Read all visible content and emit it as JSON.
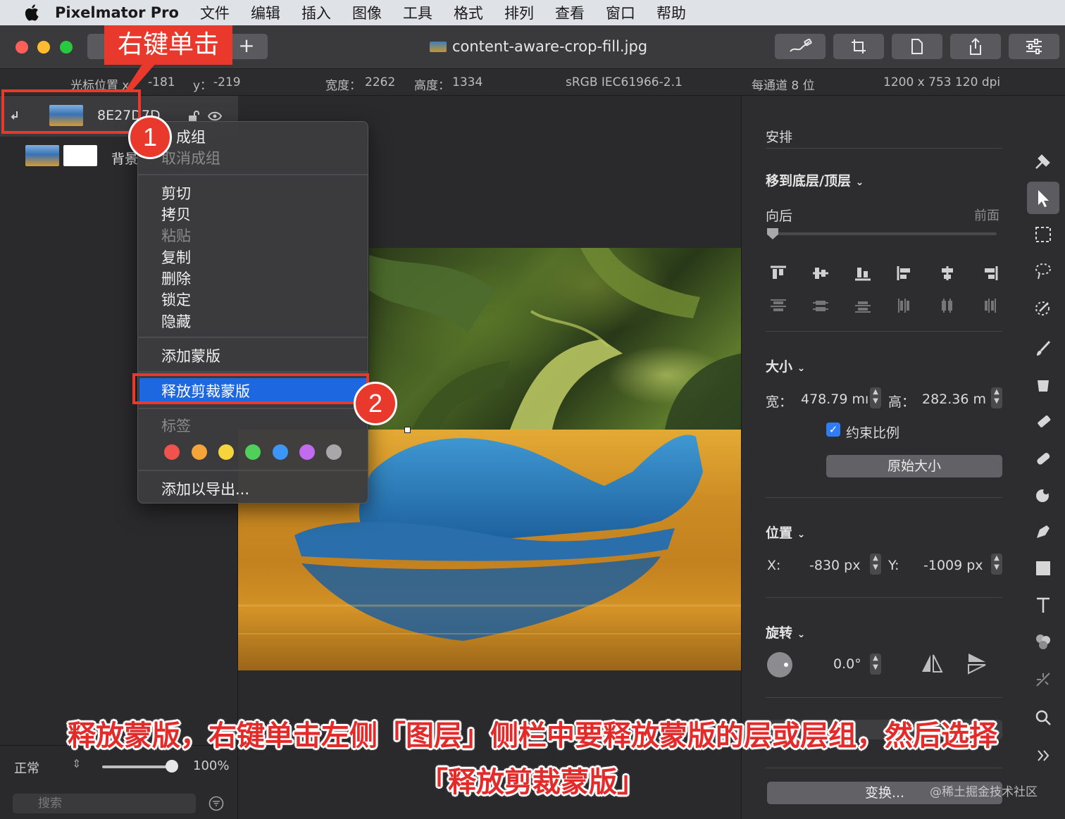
{
  "menubar": {
    "app_name": "Pixelmator Pro",
    "items": [
      "文件",
      "编辑",
      "插入",
      "图像",
      "工具",
      "格式",
      "排列",
      "查看",
      "窗口",
      "帮助"
    ]
  },
  "window": {
    "title": "content-aware-crop-fill.jpg",
    "add_label": "+"
  },
  "infobar": {
    "cursor_x_label": "光标位置 x：",
    "cursor_x": "-181",
    "cursor_y_label": "y：",
    "cursor_y": "-219",
    "width_label": "宽度：",
    "width": "2262",
    "height_label": "高度：",
    "height": "1334",
    "color_profile": "sRGB IEC61966-2.1",
    "bit_depth": "每通道 8 位",
    "resolution": "1200 x 753 120 dpi"
  },
  "layers": {
    "selected_name": "8E27D7D",
    "background_name": "背景"
  },
  "sidebar_bottom": {
    "blend_mode": "正常",
    "opacity": "100%",
    "opacity_value": 1.0,
    "search_placeholder": "搜索"
  },
  "context_menu": {
    "group": "成组",
    "ungroup": "取消成组",
    "cut": "剪切",
    "copy": "拷贝",
    "paste": "粘贴",
    "duplicate": "复制",
    "delete": "删除",
    "lock": "锁定",
    "hide": "隐藏",
    "add_mask": "添加蒙版",
    "release_clipping_mask": "释放剪裁蒙版",
    "tags_label": "标签",
    "tag_colors": [
      "#f0524c",
      "#f5a43a",
      "#f5d43c",
      "#4fd05a",
      "#3b96f5",
      "#c36bf0",
      "#a8a8aa"
    ],
    "add_to_export": "添加以导出..."
  },
  "inspector": {
    "arrange_title": "安排",
    "move_to_bottom_top": "移到底层/顶层",
    "backward": "向后",
    "forward": "前面",
    "size_title": "大小",
    "width_label": "宽：",
    "width_value": "478.79 mı",
    "height_label": "高：",
    "height_value": "282.36 m",
    "constrain": "约束比例",
    "original_size": "原始大小",
    "position_title": "位置",
    "x_label": "X:",
    "x_value": "-830 px",
    "y_label": "Y:",
    "y_value": "-1009 px",
    "rotation_title": "旋转",
    "rotation_value": "0.0°",
    "transform": "变换..."
  },
  "annotations": {
    "right_click_label": "右键单击",
    "step1": "1",
    "step2": "2",
    "caption_line1": "释放蒙版，右键单击左侧「图层」侧栏中要释放蒙版的层或层组，然后选择",
    "caption_line2": "「释放剪裁蒙版」",
    "watermark": "@稀土掘金技术社区"
  },
  "colors": {
    "accent_blue": "#1d67e0",
    "annotation_red": "#e8392c"
  }
}
